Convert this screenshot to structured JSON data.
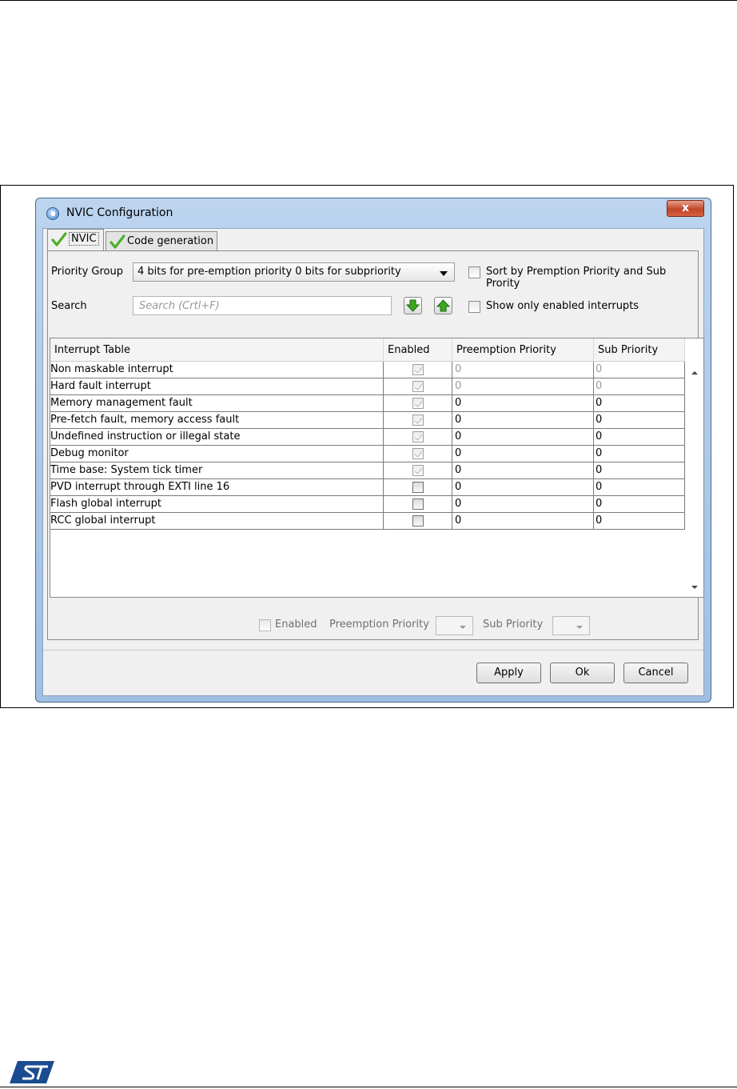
{
  "window": {
    "title": "NVIC Configuration",
    "close_label": "x"
  },
  "tabs": [
    {
      "label": "NVIC",
      "active": true
    },
    {
      "label": "Code generation",
      "active": false
    }
  ],
  "priority_group": {
    "label": "Priority Group",
    "selected": "4 bits for pre-emption priority 0 bits for subpriority"
  },
  "sort_checkbox": {
    "label": "Sort by Premption Priority and Sub Prority",
    "checked": false
  },
  "search": {
    "label": "Search",
    "placeholder": "Search (Crtl+F)"
  },
  "show_enabled_checkbox": {
    "label": "Show only enabled interrupts",
    "checked": false
  },
  "table": {
    "columns": [
      "Interrupt Table",
      "Enabled",
      "Preemption Priority",
      "Sub Priority"
    ],
    "rows": [
      {
        "name": "Non maskable interrupt",
        "enabled": true,
        "locked": true,
        "preemption": "0",
        "sub": "0",
        "dim": true
      },
      {
        "name": "Hard fault interrupt",
        "enabled": true,
        "locked": true,
        "preemption": "0",
        "sub": "0",
        "dim": true
      },
      {
        "name": "Memory management fault",
        "enabled": true,
        "locked": true,
        "preemption": "0",
        "sub": "0",
        "dim": false
      },
      {
        "name": "Pre-fetch fault, memory access fault",
        "enabled": true,
        "locked": true,
        "preemption": "0",
        "sub": "0",
        "dim": false
      },
      {
        "name": "Undefined instruction or illegal state",
        "enabled": true,
        "locked": true,
        "preemption": "0",
        "sub": "0",
        "dim": false
      },
      {
        "name": "Debug monitor",
        "enabled": true,
        "locked": true,
        "preemption": "0",
        "sub": "0",
        "dim": false
      },
      {
        "name": "Time base: System tick timer",
        "enabled": true,
        "locked": true,
        "preemption": "0",
        "sub": "0",
        "dim": false
      },
      {
        "name": "PVD interrupt through EXTI line 16",
        "enabled": false,
        "locked": false,
        "preemption": "0",
        "sub": "0",
        "dim": false
      },
      {
        "name": "Flash global interrupt",
        "enabled": false,
        "locked": false,
        "preemption": "0",
        "sub": "0",
        "dim": false
      },
      {
        "name": "RCC global interrupt",
        "enabled": false,
        "locked": false,
        "preemption": "0",
        "sub": "0",
        "dim": false
      }
    ]
  },
  "detail": {
    "enabled_label": "Enabled",
    "preemption_label": "Preemption Priority",
    "sub_label": "Sub Priority"
  },
  "buttons": {
    "apply": "Apply",
    "ok": "Ok",
    "cancel": "Cancel"
  },
  "colors": {
    "check_green": "#4caf2a",
    "arrow_green": "#3aa822",
    "st_blue": "#1a4c8f"
  },
  "icons": [
    "shield-icon",
    "checkmark-icon",
    "arrow-down-icon",
    "arrow-up-icon",
    "st-logo"
  ]
}
